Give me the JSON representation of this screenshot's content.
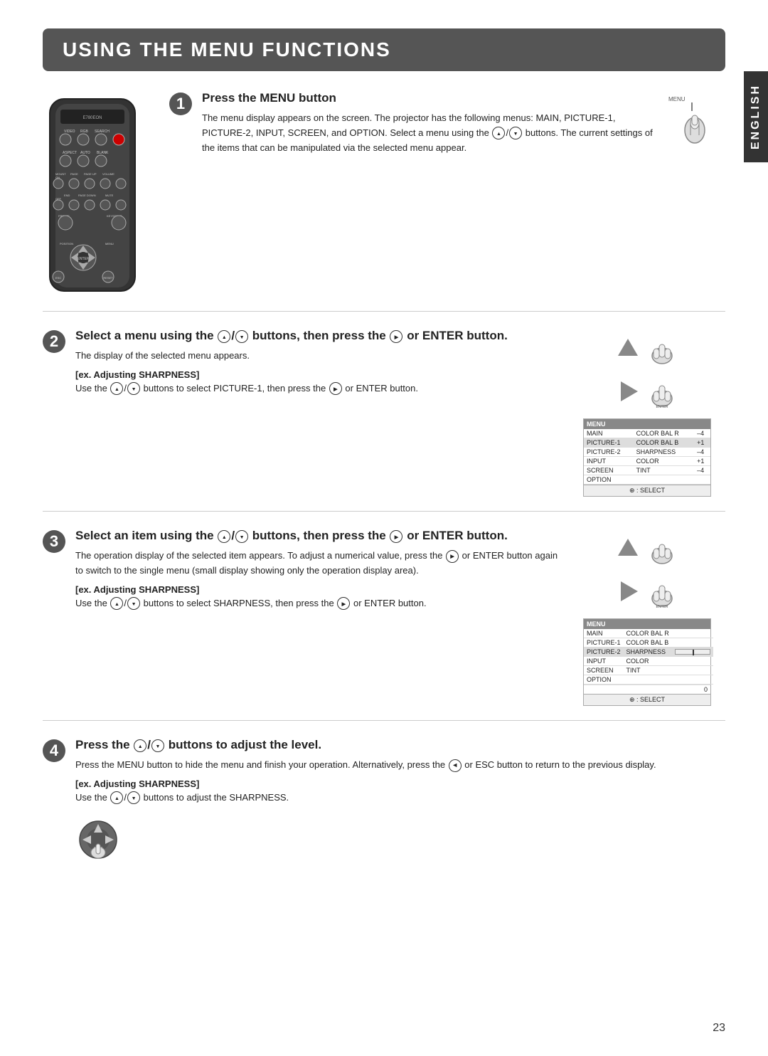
{
  "title": "USING THE MENU FUNCTIONS",
  "english_label": "ENGLISH",
  "page_number": "23",
  "steps": [
    {
      "num": "1",
      "heading": "Press the MENU button",
      "body": "The menu display appears on the screen. The projector has the following menus: MAIN, PICTURE-1, PICTURE-2, INPUT, SCREEN, and OPTION. Select a menu using the ▲/▼ buttons. The current settings of the items that can be manipulated via the selected menu appear."
    },
    {
      "num": "2",
      "heading": "Select a menu using the ▲/▼ buttons, then press the ► or ENTER button.",
      "intro": "The display of the selected menu appears.",
      "ex": "[ex. Adjusting SHARPNESS]",
      "body": "Use the ▲/▼ buttons to select PICTURE-1, then press the ► or ENTER button."
    },
    {
      "num": "3",
      "heading": "Select an item using the ▲/▼ buttons, then press the ► or ENTER button.",
      "body": "The operation display of the selected item appears. To adjust a numerical value, press the ► or ENTER button again to switch to the single menu (small display showing only the operation display area).",
      "ex": "[ex. Adjusting SHARPNESS]",
      "body2": "Use the ▲/▼ buttons to select SHARPNESS, then press the ► or ENTER button."
    },
    {
      "num": "4",
      "heading": "Press the ▲/▼ buttons to adjust the level.",
      "body": "Press the MENU button to hide the menu and finish your operation. Alternatively, press the ◄ or ESC button to return to the previous display.",
      "ex": "[ex. Adjusting SHARPNESS]",
      "body2": "Use the ▲/▼ buttons to adjust the SHARPNESS."
    }
  ],
  "menu_table": {
    "title": "MENU",
    "rows": [
      {
        "col1": "MAIN",
        "col2": "COLOR BAL R",
        "col3": "–4"
      },
      {
        "col1": "PICTURE-1",
        "col2": "COLOR BAL B",
        "col3": "+1"
      },
      {
        "col1": "PICTURE-2",
        "col2": "SHARPNESS",
        "col3": "–4"
      },
      {
        "col1": "INPUT",
        "col2": "COLOR",
        "col3": "+1"
      },
      {
        "col1": "SCREEN",
        "col2": "TINT",
        "col3": "–4"
      },
      {
        "col1": "OPTION",
        "col2": "",
        "col3": ""
      }
    ],
    "footer": "⊕ : SELECT"
  },
  "menu_table2": {
    "title": "MENU",
    "rows": [
      {
        "col1": "MAIN",
        "col2": "COLOR BAL R",
        "col3": ""
      },
      {
        "col1": "PICTURE-1",
        "col2": "COLOR BAL B",
        "col3": ""
      },
      {
        "col1": "PICTURE-2",
        "col2": "SHARPNESS",
        "col3": "",
        "slider": true
      },
      {
        "col1": "INPUT",
        "col2": "COLOR",
        "col3": ""
      },
      {
        "col1": "SCREEN",
        "col2": "TINT",
        "col3": ""
      },
      {
        "col1": "OPTION",
        "col2": "",
        "col3": ""
      }
    ],
    "footer": "⊕ : SELECT",
    "value_label": "0"
  }
}
